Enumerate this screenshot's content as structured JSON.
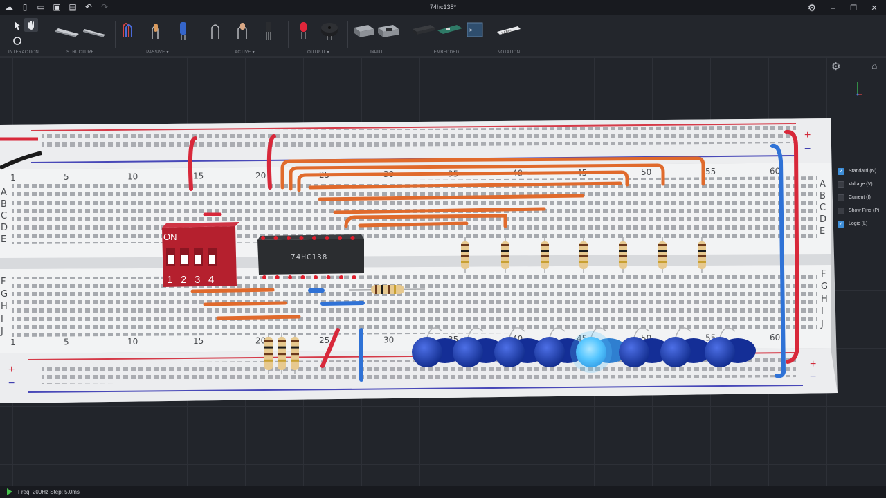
{
  "window": {
    "title": "74hc138*"
  },
  "toolbar": {
    "groups": [
      {
        "label": "INTERACTION"
      },
      {
        "label": "STRUCTURE"
      },
      {
        "label": "PASSIVE ▾"
      },
      {
        "label": "ACTIVE ▾"
      },
      {
        "label": "OUTPUT ▾"
      },
      {
        "label": "INPUT"
      },
      {
        "label": "EMBEDDED"
      },
      {
        "label": "NOTATION"
      }
    ]
  },
  "breadboard": {
    "column_numbers": [
      "1",
      "5",
      "10",
      "15",
      "20",
      "25",
      "30",
      "35",
      "40",
      "45",
      "50",
      "55",
      "60"
    ],
    "rows_top": [
      "A",
      "B",
      "C",
      "D",
      "E"
    ],
    "rows_bottom": [
      "F",
      "G",
      "H",
      "I",
      "J"
    ],
    "plus": "+",
    "minus": "−",
    "chip_label": "74HC138",
    "dip_on": "ON",
    "dip_numbers": [
      "1",
      "2",
      "3",
      "4"
    ],
    "leds_lit": [
      false,
      false,
      false,
      false,
      true,
      false,
      false,
      false
    ]
  },
  "view_options": [
    {
      "label": "Standard (N)",
      "checked": true
    },
    {
      "label": "Voltage (V)",
      "checked": false
    },
    {
      "label": "Current (I)",
      "checked": false
    },
    {
      "label": "Show Pins (P)",
      "checked": false
    },
    {
      "label": "Logic (L)",
      "checked": true
    }
  ],
  "status": {
    "text": "Freq: 200Hz  Step: 5.0ms"
  },
  "colors": {
    "accent": "#3e8ed8",
    "wire_orange": "#e06a2c",
    "wire_red": "#d8283a",
    "wire_blue": "#2f72d6",
    "led_blue": "#1c3fb5",
    "led_lit": "#58c8ff",
    "chip_body": "#2b2d30",
    "dip_red": "#b5202e"
  }
}
